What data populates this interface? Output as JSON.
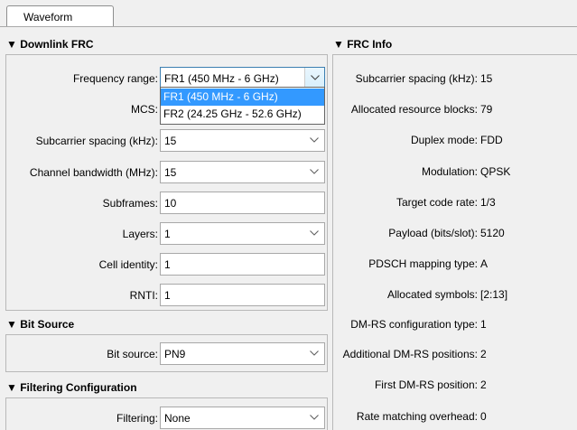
{
  "tab": {
    "label": "Waveform"
  },
  "downlink": {
    "title": "▼ Downlink FRC",
    "frequency_range": {
      "label": "Frequency range:",
      "value": "FR1 (450 MHz - 6 GHz)",
      "options": [
        "FR1 (450 MHz - 6 GHz)",
        "FR2 (24.25 GHz - 52.6 GHz)"
      ]
    },
    "mcs": {
      "label": "MCS:"
    },
    "subcarrier_spacing": {
      "label": "Subcarrier spacing (kHz):",
      "value": "15"
    },
    "channel_bandwidth": {
      "label": "Channel bandwidth (MHz):",
      "value": "15"
    },
    "subframes": {
      "label": "Subframes:",
      "value": "10"
    },
    "layers": {
      "label": "Layers:",
      "value": "1"
    },
    "cell_identity": {
      "label": "Cell identity:",
      "value": "1"
    },
    "rnti": {
      "label": "RNTI:",
      "value": "1"
    }
  },
  "bit_source": {
    "title": "▼ Bit Source",
    "label": "Bit source:",
    "value": "PN9"
  },
  "filtering": {
    "title": "▼ Filtering Configuration",
    "label": "Filtering:",
    "value": "None"
  },
  "frc_info": {
    "title": "▼ FRC Info",
    "rows": [
      {
        "label": "Subcarrier spacing (kHz):",
        "value": "15"
      },
      {
        "label": "Allocated resource blocks:",
        "value": "79"
      },
      {
        "label": "Duplex mode:",
        "value": "FDD"
      },
      {
        "label": "Modulation:",
        "value": "QPSK"
      },
      {
        "label": "Target code rate:",
        "value": "1/3"
      },
      {
        "label": "Payload (bits/slot):",
        "value": "5120"
      },
      {
        "label": "PDSCH mapping type:",
        "value": "A"
      },
      {
        "label": "Allocated symbols:",
        "value": "[2:13]"
      },
      {
        "label": "DM-RS configuration type:",
        "value": "1"
      },
      {
        "label": "Additional DM-RS positions:",
        "value": "2"
      },
      {
        "label": "First DM-RS position:",
        "value": "2"
      },
      {
        "label": "Rate matching overhead:",
        "value": "0"
      }
    ]
  },
  "icons": {
    "combo_arrow": "chevron-down-icon"
  }
}
